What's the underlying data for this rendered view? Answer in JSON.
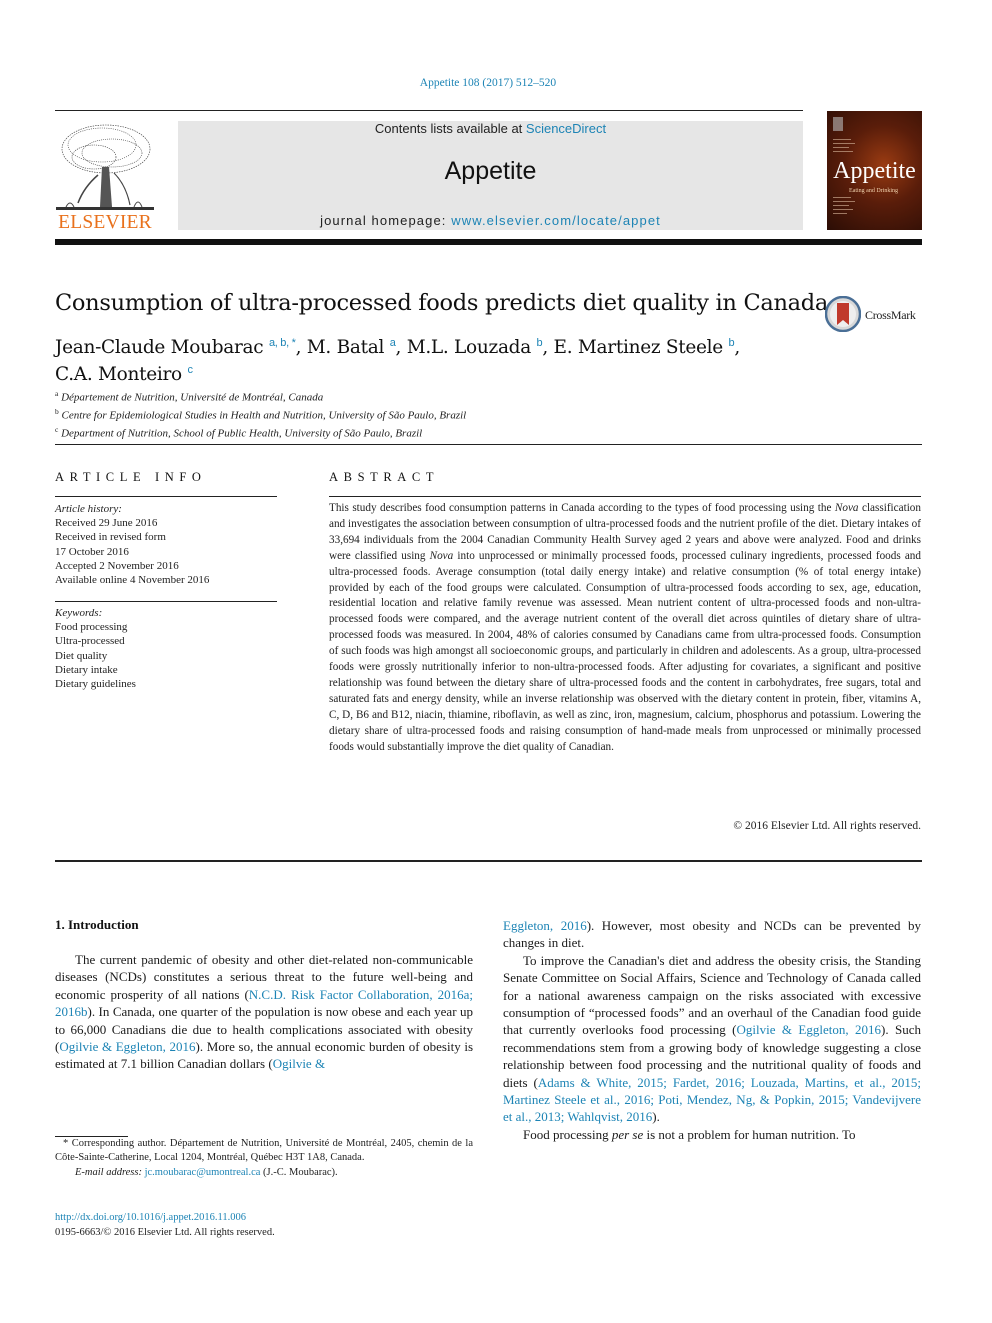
{
  "journal_ref": "Appetite 108 (2017) 512–520",
  "header": {
    "publisher": "ELSEVIER",
    "contents_prefix": "Contents lists available at ",
    "contents_link": "ScienceDirect",
    "journal_title": "Appetite",
    "homepage_prefix": "journal homepage: ",
    "homepage_link": "www.elsevier.com/locate/appet",
    "cover_title": "Appetite",
    "cover_subtitle": "Eating and Drinking"
  },
  "article": {
    "title": "Consumption of ultra-processed foods predicts diet quality in Canada",
    "crossmark_label": "CrossMark",
    "authors": [
      {
        "name": "Jean-Claude Moubarac",
        "sup": "a, b, *",
        "sep": ", "
      },
      {
        "name": "M. Batal",
        "sup": "a",
        "sep": ", "
      },
      {
        "name": "M.L. Louzada",
        "sup": "b",
        "sep": ", "
      },
      {
        "name": "E. Martinez Steele",
        "sup": "b",
        "sep": ","
      },
      {
        "name": "C.A. Monteiro",
        "sup": "c",
        "sep": ""
      }
    ],
    "affiliations": [
      {
        "mark": "a",
        "text": "Département de Nutrition, Université de Montréal, Canada"
      },
      {
        "mark": "b",
        "text": "Centre for Epidemiological Studies in Health and Nutrition, University of São Paulo, Brazil"
      },
      {
        "mark": "c",
        "text": "Department of Nutrition, School of Public Health, University of São Paulo, Brazil"
      }
    ]
  },
  "article_info": {
    "heading": "ARTICLE INFO",
    "history_label": "Article history:",
    "history": [
      "Received 29 June 2016",
      "Received in revised form",
      "17 October 2016",
      "Accepted 2 November 2016",
      "Available online 4 November 2016"
    ],
    "keywords_label": "Keywords:",
    "keywords": [
      "Food processing",
      "Ultra-processed",
      "Diet quality",
      "Dietary intake",
      "Dietary guidelines"
    ]
  },
  "abstract": {
    "heading": "ABSTRACT",
    "parts": [
      {
        "t": "This study describes food consumption patterns in Canada according to the types of food processing using the ",
        "i": false
      },
      {
        "t": "Nova",
        "i": true
      },
      {
        "t": " classification and investigates the association between consumption of ultra-processed foods and the nutrient profile of the diet. Dietary intakes of 33,694 individuals from the 2004 Canadian Community Health Survey aged 2 years and above were analyzed. Food and drinks were classified using ",
        "i": false
      },
      {
        "t": "Nova",
        "i": true
      },
      {
        "t": " into unprocessed or minimally processed foods, processed culinary ingredients, processed foods and ultra-processed foods. Average consumption (total daily energy intake) and relative consumption (% of total energy intake) provided by each of the food groups were calculated. Consumption of ultra-processed foods according to sex, age, education, residential location and relative family revenue was assessed. Mean nutrient content of ultra-processed foods and non-ultra-processed foods were compared, and the average nutrient content of the overall diet across quintiles of dietary share of ultra-processed foods was measured. In 2004, 48% of calories consumed by Canadians came from ultra-processed foods. Consumption of such foods was high amongst all socioeconomic groups, and particularly in children and adolescents. As a group, ultra-processed foods were grossly nutritionally inferior to non-ultra-processed foods. After adjusting for covariates, a significant and positive relationship was found between the dietary share of ultra-processed foods and the content in carbohydrates, free sugars, total and saturated fats and energy density, while an inverse relationship was observed with the dietary content in protein, fiber, vitamins A, C, D, B6 and B12, niacin, thiamine, riboflavin, as well as zinc, iron, magnesium, calcium, phosphorus and potassium. Lowering the dietary share of ultra-processed foods and raising consumption of hand-made meals from unprocessed or minimally processed foods would substantially improve the diet quality of Canadian.",
        "i": false
      }
    ],
    "copyright": "© 2016 Elsevier Ltd. All rights reserved."
  },
  "intro": {
    "heading": "1.  Introduction",
    "left_col": [
      {
        "t": "The current pandemic of obesity and other diet-related non-communicable diseases (NCDs) constitutes a serious threat to the future well-being and economic prosperity of all nations (",
        "l": false
      },
      {
        "t": "N.C.D. Risk Factor Collaboration, 2016a; 2016b",
        "l": true
      },
      {
        "t": "). In Canada, one quarter of the population is now obese and each year up to 66,000 Canadians die due to health complications associated with obesity (",
        "l": false
      },
      {
        "t": "Ogilvie & Eggleton, 2016",
        "l": true
      },
      {
        "t": "). More so, the annual economic burden of obesity is estimated at 7.1 billion Canadian dollars (",
        "l": false
      },
      {
        "t": "Ogilvie &",
        "l": true
      }
    ],
    "right_col_p1": [
      {
        "t": "Eggleton, 2016",
        "l": true
      },
      {
        "t": "). However, most obesity and NCDs can be prevented by changes in diet.",
        "l": false
      }
    ],
    "right_col_p2": [
      {
        "t": "To improve the Canadian's diet and address the obesity crisis, the Standing Senate Committee on Social Affairs, Science and Technology of Canada called for a national awareness campaign on the risks associated with excessive consumption of “processed foods” and an overhaul of the Canadian food guide that currently overlooks food processing (",
        "l": false
      },
      {
        "t": "Ogilvie & Eggleton, 2016",
        "l": true
      },
      {
        "t": "). Such recommendations stem from a growing body of knowledge suggesting a close relationship between food processing and the nutritional quality of foods and diets (",
        "l": false
      },
      {
        "t": "Adams & White, 2015; Fardet, 2016; Louzada, Martins, et al., 2015; Martinez Steele et al., 2016; Poti, Mendez, Ng, & Popkin, 2015; Vandevijvere et al., 2013; Wahlqvist, 2016",
        "l": true
      },
      {
        "t": ").",
        "l": false
      }
    ],
    "right_col_p3_a": "Food processing ",
    "right_col_p3_i": "per se",
    "right_col_p3_b": " is not a problem for human nutrition. To"
  },
  "footnote": {
    "corresponding": "* Corresponding author. Département de Nutrition, Université de Montréal, 2405, chemin de la Côte-Sainte-Catherine, Local 1204, Montréal, Québec H3T 1A8, Canada.",
    "email_label": "E-mail address: ",
    "email": "jc.moubarac@umontreal.ca",
    "email_suffix": " (J.-C. Moubarac).",
    "doi": "http://dx.doi.org/10.1016/j.appet.2016.11.006",
    "issn": "0195-6663/© 2016 Elsevier Ltd. All rights reserved."
  },
  "colors": {
    "link": "#1d84b5",
    "elsevier_orange": "#e9711c",
    "header_box": "#e6e6e6"
  }
}
